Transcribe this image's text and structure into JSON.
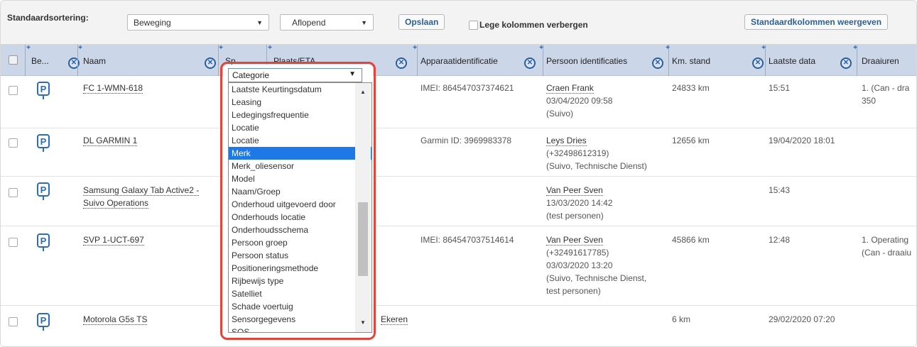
{
  "toolbar": {
    "sort_label": "Standaardsortering:",
    "sort_field": "Beweging",
    "sort_order": "Aflopend",
    "save_label": "Opslaan",
    "hide_empty_label": "Lege kolommen verbergen",
    "show_default_label": "Standaardkolommen weergeven"
  },
  "columns": {
    "be": "Be...",
    "naam": "Naam",
    "sp": "Sp",
    "plaats": "Plaats/ETA",
    "apparaat": "Apparaatidentificatie",
    "persoon": "Persoon identificaties",
    "km": "Km. stand",
    "laatste": "Laatste data",
    "draai": "Draaiuren"
  },
  "rows": [
    {
      "naam": "FC 1-WMN-618",
      "apparaat": "IMEI: 864547037374621",
      "persoon_name": "Craen Frank",
      "persoon_lines": [
        "03/04/2020 09:58",
        "(Suivo)"
      ],
      "km": "24833 km",
      "laatste": "15:51",
      "draai": [
        "1. (Can - dra",
        "350"
      ]
    },
    {
      "naam": "DL GARMIN 1",
      "apparaat": "Garmin ID: 3969983378",
      "persoon_name": "Leys Dries",
      "persoon_lines": [
        "(+32498612319)",
        "(Suivo, Technische Dienst)"
      ],
      "km": "12656 km",
      "laatste": "19/04/2020 18:01",
      "draai": []
    },
    {
      "naam_lines": [
        "Samsung Galaxy Tab Active2 -",
        "Suivo Operations"
      ],
      "apparaat": "",
      "persoon_name": "Van Peer Sven",
      "persoon_lines": [
        "13/03/2020 14:42",
        "(test personen)"
      ],
      "km": "",
      "laatste": "15:43",
      "draai": []
    },
    {
      "naam": "SVP 1-UCT-697",
      "apparaat": "IMEI: 864547037514614",
      "persoon_name": "Van Peer Sven",
      "persoon_lines": [
        "(+32491617785)",
        "03/03/2020 13:20",
        "(Suivo, Technische Dienst,",
        "test personen)"
      ],
      "km": "45866 km",
      "laatste": "12:48",
      "draai": [
        "1. Operating",
        "(Can - draaiu"
      ]
    },
    {
      "naam": "Motorola G5s TS",
      "plaats_fragment": "Ekeren",
      "apparaat": "",
      "persoon_name": "",
      "persoon_lines": [],
      "km": "6 km",
      "laatste": "29/02/2020 07:20",
      "draai": []
    }
  ],
  "dropdown": {
    "selected_label": "Categorie",
    "highlighted": "Merk",
    "options": [
      "Laatste Keurtingsdatum",
      "Leasing",
      "Ledegingsfrequentie",
      "Locatie",
      "Locatie",
      "Merk",
      "Merk_oliesensor",
      "Model",
      "Naam/Groep",
      "Onderhoud uitgevoerd door",
      "Onderhouds locatie",
      "Onderhoudsschema",
      "Persoon groep",
      "Persoon status",
      "Positioneringsmethode",
      "Rijbewijs type",
      "Satelliet",
      "Schade voertuig",
      "Sensorgegevens",
      "SOS"
    ]
  },
  "colors": {
    "accent": "#2a5f9e",
    "header_bg": "#cbd6e8",
    "highlight_outline": "#e0473a",
    "selected_option": "#1e78e6"
  },
  "icons": {
    "parking": "parking-icon",
    "remove": "remove-column-icon",
    "add": "add-column-icon"
  }
}
